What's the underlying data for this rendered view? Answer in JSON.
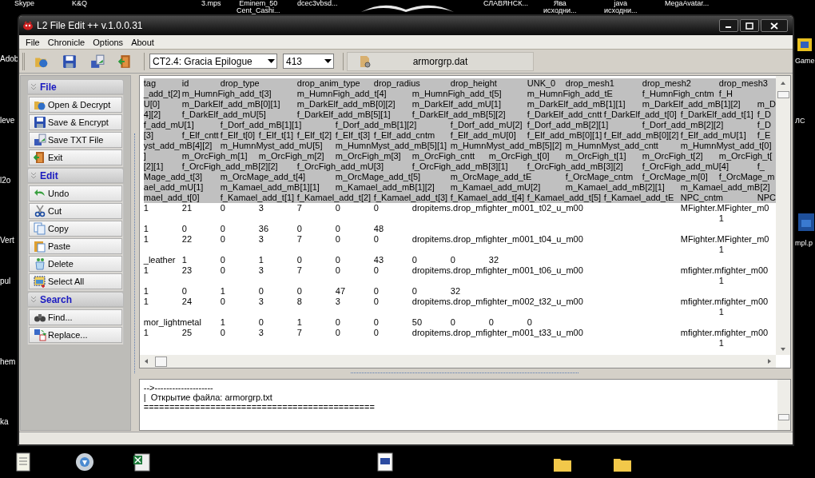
{
  "desktop": {
    "top_labels": [
      {
        "lines": [
          "Skype"
        ]
      },
      {
        "lines": [
          "K&Q"
        ]
      },
      {
        "lines": [
          "3.mps"
        ]
      },
      {
        "lines": [
          "Eminem_50",
          "Cent_Cashi..."
        ]
      },
      {
        "lines": [
          "dcec3vbsd..."
        ]
      },
      {
        "lines": [
          "СЛАВЯНСК..."
        ]
      },
      {
        "lines": [
          "Ява",
          "исходни..."
        ]
      },
      {
        "lines": [
          "java",
          "исходни..."
        ]
      },
      {
        "lines": [
          "MegaAvatar..."
        ]
      }
    ],
    "left_labels": [
      "Adob",
      "leve",
      "l2o",
      "Vert",
      "pul",
      "hem",
      "ka"
    ],
    "right_labels": [
      "Game",
      "ЛС",
      "mpl.p"
    ]
  },
  "window": {
    "title": "L2 File Edit ++ v.1.0.0.31"
  },
  "menu": [
    "File",
    "Chronicle",
    "Options",
    "About"
  ],
  "toolbar": {
    "chronicle": {
      "value": "CT2.4: Gracia Epilogue"
    },
    "protocol": {
      "value": "413"
    },
    "file_name": "armorgrp.dat"
  },
  "sidebar": [
    {
      "title": "File",
      "items": [
        "Open & Decrypt",
        "Save & Encrypt",
        "Save TXT File",
        "Exit"
      ]
    },
    {
      "title": "Edit",
      "items": [
        "Undo",
        "Cut",
        "Copy",
        "Paste",
        "Delete",
        "Select All"
      ]
    },
    {
      "title": "Search",
      "items": [
        "Find...",
        "Replace..."
      ]
    }
  ],
  "editor": {
    "lines": [
      {
        "text": "tag\tid\tdrop_type\tdrop_anim_type\tdrop_radius\tdrop_height\tUNK_0\tdrop_mesh1\tdrop_mesh2\tdrop_mesh3",
        "selected": true
      },
      {
        "text": "_add_t[2]\tm_HumnFigh_add_t[3]\tm_HumnFigh_add_t[4]\tm_HumnFigh_add_t[5]\tm_HumnFigh_add_tE\tf_HumnFigh_cntm\tf_H",
        "selected": true
      },
      {
        "text": "U[0]\tm_DarkElf_add_mB[0][1]\tm_DarkElf_add_mB[0][2]\tm_DarkElf_add_mU[1]\tm_DarkElf_add_mB[1][1]\tm_DarkElf_add_mB[1][2]\tm_D",
        "selected": true
      },
      {
        "text": "4][2]\tf_DarkElf_add_mU[5]\tf_DarkElf_add_mB[5][1]\tf_DarkElf_add_mB[5][2]\tf_DarkElf_add_cntt\tf_DarkElf_add_t[0]\tf_DarkElf_add_t[1]\tf_D",
        "selected": true
      },
      {
        "text": "f_add_mU[1]\tf_Dorf_add_mB[1][1]\tf_Dorf_add_mB[1][2]\tf_Dorf_add_mU[2]\tf_Dorf_add_mB[2][1]\tf_Dorf_add_mB[2][2]\tf_D",
        "selected": true
      },
      {
        "text": "[3]\tf_Elf_cntt\tf_Elf_t[0]\tf_Elf_t[1]\tf_Elf_t[2]\tf_Elf_t[3]\tf_Elf_add_cntm\tf_Elf_add_mU[0]\tf_Elf_add_mB[0][1]\tf_Elf_add_mB[0][2]\tf_Elf_add_mU[1]\tf_E",
        "selected": true
      },
      {
        "text": "yst_add_mB[4][2]\tm_HumnMyst_add_mU[5]\tm_HumnMyst_add_mB[5][1]\tm_HumnMyst_add_mB[5][2]\tm_HumnMyst_add_cntt\tm_HumnMyst_add_t[0]",
        "selected": true
      },
      {
        "text": "]\tm_OrcFigh_m[1]\tm_OrcFigh_m[2]\tm_OrcFigh_m[3]\tm_OrcFigh_cntt\tm_OrcFigh_t[0]\tm_OrcFigh_t[1]\tm_OrcFigh_t[2]\tm_OrcFigh_t[",
        "selected": true
      },
      {
        "text": "[2][1]\tf_OrcFigh_add_mB[2][2]\tf_OrcFigh_add_mU[3]\tf_OrcFigh_add_mB[3][1]\tf_OrcFigh_add_mB[3][2]\tf_OrcFigh_add_mU[4]\tf_",
        "selected": true
      },
      {
        "text": "Mage_add_t[3]\tm_OrcMage_add_t[4]\tm_OrcMage_add_t[5]\tm_OrcMage_add_tE\tf_OrcMage_cntm\tf_OrcMage_m[0]\tf_OrcMage_m",
        "selected": true
      },
      {
        "text": "ael_add_mU[1]\tm_Kamael_add_mB[1][1]\tm_Kamael_add_mB[1][2]\tm_Kamael_add_mU[2]\tm_Kamael_add_mB[2][1]\tm_Kamael_add_mB[2]",
        "selected": true
      },
      {
        "text": "mael_add_t[0]\tf_Kamael_add_t[1]\tf_Kamael_add_t[2]\tf_Kamael_add_t[3]\tf_Kamael_add_t[4]\tf_Kamael_add_t[5]\tf_Kamael_add_tE\tNPC_cntm\tNPC",
        "selected": true
      },
      {
        "text": "1\t21\t0\t3\t7\t0\t0\tdropitems.drop_mfighter_m001_t02_u_m00\t\t\tMFighter.MFighter_m0",
        "selected": false
      },
      {
        "text": "\t\t\t\t\t\t\t\t\t\t\t\t\t\t\t1",
        "selected": false
      },
      {
        "text": "1\t0\t0\t36\t0\t0\t48",
        "selected": false
      },
      {
        "text": "1\t22\t0\t3\t7\t0\t0\tdropitems.drop_mfighter_m001_t04_u_m00\t\t\tMFighter.MFighter_m0",
        "selected": false
      },
      {
        "text": "\t\t\t\t\t\t\t\t\t\t\t\t\t\t\t1",
        "selected": false
      },
      {
        "text": "_leather\t1\t0\t1\t0\t0\t43\t0\t0\t32",
        "selected": false
      },
      {
        "text": "1\t23\t0\t3\t7\t0\t0\tdropitems.drop_mfighter_m001_t06_u_m00\t\t\tmfighter.mfighter_m00",
        "selected": false
      },
      {
        "text": "\t\t\t\t\t\t\t\t\t\t\t\t\t\t\t1",
        "selected": false
      },
      {
        "text": "1\t0\t1\t0\t0\t47\t0\t0\t32",
        "selected": false
      },
      {
        "text": "1\t24\t0\t3\t8\t3\t0\tdropitems.drop_mfighter_m002_t32_u_m00\t\t\tmfighter.mfighter_m00",
        "selected": false
      },
      {
        "text": "\t\t\t\t\t\t\t\t\t\t\t\t\t\t\t1",
        "selected": false
      },
      {
        "text": "mor_lightmetal\t1\t0\t1\t0\t0\t50\t0\t0\t0",
        "selected": false
      },
      {
        "text": "1\t25\t0\t3\t7\t0\t0\tdropitems.drop_mfighter_m001_t33_u_m00\t\t\tmfighter.mfighter_m00",
        "selected": false
      },
      {
        "text": "\t\t\t\t\t\t\t\t\t\t\t\t\t\t\t1",
        "selected": false
      }
    ]
  },
  "log": {
    "lines": [
      "-->--------------------",
      "|  Открытие файла: armorgrp.txt",
      "============================================="
    ]
  }
}
